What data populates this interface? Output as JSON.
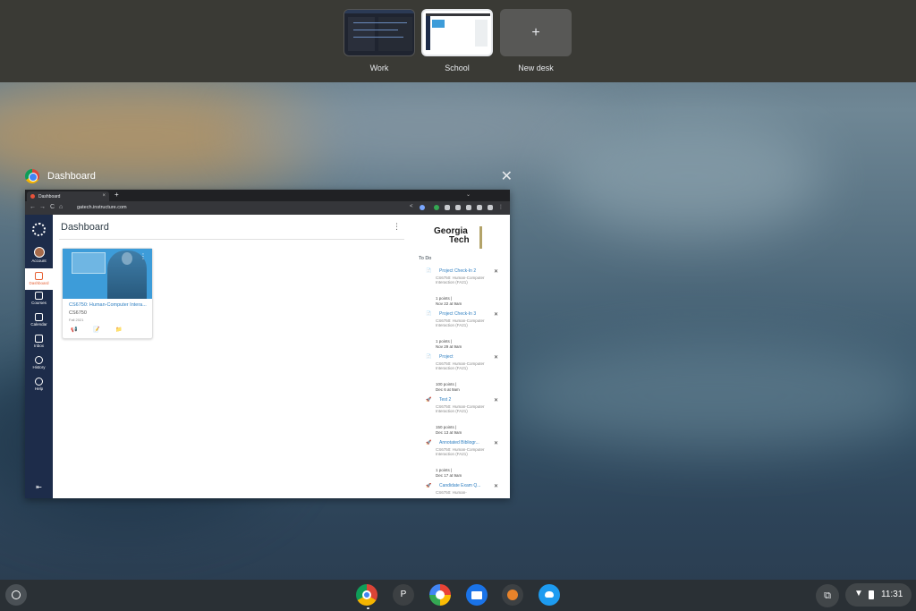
{
  "desks": [
    {
      "label": "Work"
    },
    {
      "label": "School"
    },
    {
      "label": "New desk",
      "icon": "plus-icon",
      "glyph": "+"
    }
  ],
  "window": {
    "title": "Dashboard",
    "close_glyph": "✕"
  },
  "browser": {
    "tab_title": "Dashboard",
    "tab_close": "×",
    "new_tab": "+",
    "tab_menu": "⌄",
    "url": "gatech.instructure.com",
    "back": "←",
    "forward": "→",
    "reload": "C",
    "home": "⌂"
  },
  "nav": [
    {
      "label": "Account",
      "icon": "account-avatar-icon"
    },
    {
      "label": "Dashboard",
      "icon": "dashboard-icon",
      "active": true
    },
    {
      "label": "Courses",
      "icon": "courses-icon"
    },
    {
      "label": "Calendar",
      "icon": "calendar-icon"
    },
    {
      "label": "Inbox",
      "icon": "inbox-icon"
    },
    {
      "label": "History",
      "icon": "history-icon"
    },
    {
      "label": "Help",
      "icon": "help-icon"
    }
  ],
  "nav_collapse": "⇤",
  "dashboard": {
    "title": "Dashboard",
    "menu": "⋮",
    "card": {
      "name": "CS6750: Human-Computer Intera...",
      "code": "CS6750",
      "term": "Fall 2021",
      "menu": "⋮",
      "hero_color": "#3d9cd9"
    }
  },
  "logo": {
    "line1": "Georgia",
    "line2": "Tech"
  },
  "todo": {
    "heading": "To Do",
    "items": [
      {
        "title": "Project Check-In 2",
        "course": "CS6750: Human-Computer Interaction (FA21)",
        "points": "1 points  |",
        "due": "Nov 22 at 9am",
        "icon": "assignment-icon"
      },
      {
        "title": "Project Check-In 3",
        "course": "CS6750: Human-Computer Interaction (FA21)",
        "points": "1 points  |",
        "due": "Nov 29 at 9am",
        "icon": "assignment-icon"
      },
      {
        "title": "Project",
        "course": "CS6750: Human-Computer Interaction (FA21)",
        "points": "100 points  |",
        "due": "Dec 6 at 9am",
        "icon": "assignment-icon"
      },
      {
        "title": "Test 2",
        "course": "CS6750: Human-Computer Interaction (FA21)",
        "points": "150 points  |",
        "due": "Dec 13 at 9am",
        "icon": "quiz-icon"
      },
      {
        "title": "Annotated Bibliogr...",
        "course": "CS6750: Human-Computer Interaction (FA21)",
        "points": "1 points  |",
        "due": "Dec 17 at 9am",
        "icon": "quiz-icon"
      },
      {
        "title": "Candidate Exam Q...",
        "course": "CS6750: Human-",
        "points": "",
        "due": "",
        "icon": "quiz-icon"
      }
    ]
  },
  "shelf": {
    "apps": [
      {
        "name": "chrome",
        "color": "#db4437"
      },
      {
        "name": "p-app",
        "glyph": "P",
        "color": "#3c4043"
      },
      {
        "name": "photos",
        "color": "#fbbc04"
      },
      {
        "name": "files",
        "color": "#1a73e8"
      },
      {
        "name": "squid-app",
        "color": "#3c4043"
      },
      {
        "name": "twitter",
        "color": "#1d9bf0"
      }
    ],
    "time": "11:31"
  }
}
